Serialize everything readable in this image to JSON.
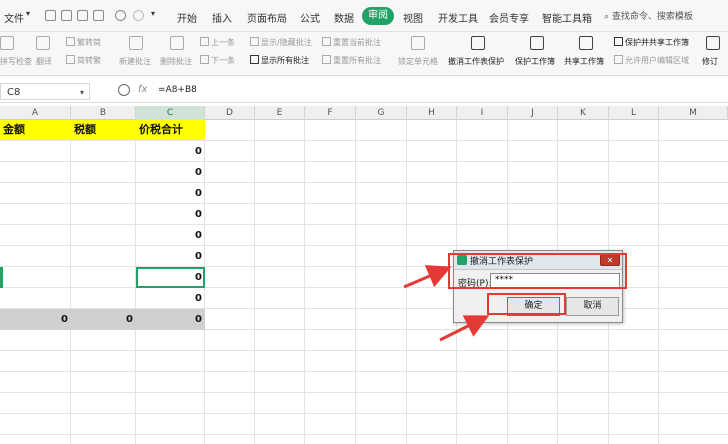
{
  "menu": {
    "file": "文件",
    "dropdown_arrow": "▾",
    "tabs": [
      "开始",
      "插入",
      "页面布局",
      "公式",
      "数据",
      "审阅",
      "视图",
      "开发工具",
      "会员专享",
      "智能工具箱"
    ],
    "active_tab": "审阅",
    "search": "查找命令、搜索模板"
  },
  "ribbon": {
    "spell_check": "拼写检查",
    "translate": "翻译",
    "simp_to_trad": "繁转简",
    "trad_to_simp": "简转繁",
    "new_comment": "新建批注",
    "delete_comment": "删除批注",
    "prev_comment": "上一条",
    "next_comment": "下一条",
    "show_hide_comment": "显示/隐藏批注",
    "show_all_comments": "显示所有批注",
    "reset_current_comment": "重置当前批注",
    "reset_all_comments": "重置所有批注",
    "lock_cell": "锁定单元格",
    "unprotect_sheet": "撤消工作表保护",
    "protect_workbook": "保护工作簿",
    "share_workbook": "共享工作簿",
    "protect_and_share": "保护并共享工作簿",
    "allow_edit_ranges": "允许用户编辑区域",
    "revise": "修订"
  },
  "formula_bar": {
    "name_box": "C8",
    "fx": "fx",
    "formula": "=A8+B8"
  },
  "columns": [
    "A",
    "B",
    "C",
    "D",
    "E",
    "F",
    "G",
    "H",
    "I",
    "J",
    "K",
    "L",
    "M"
  ],
  "selected_column": "C",
  "sheet": {
    "headers": [
      "金额",
      "税额",
      "价税合计"
    ],
    "c_values": [
      "0",
      "0",
      "0",
      "0",
      "0",
      "0",
      "0",
      "0"
    ],
    "total_row": [
      "0",
      "0",
      "0"
    ]
  },
  "dialog": {
    "title": "撤消工作表保护",
    "close": "✕",
    "password_label": "密码(P):",
    "password_value": "****",
    "ok": "确定",
    "cancel": "取消"
  },
  "colors": {
    "accent": "#21a366",
    "highlight": "#ffff00",
    "annotation": "#e53935"
  }
}
